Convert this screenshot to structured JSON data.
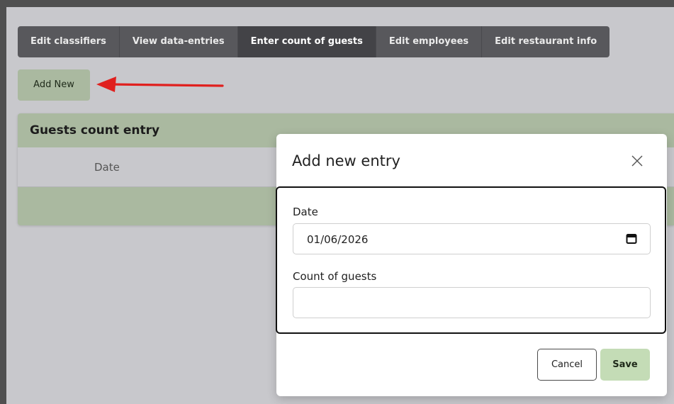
{
  "nav": {
    "items": [
      {
        "label": "Edit classifiers"
      },
      {
        "label": "View data-entries"
      },
      {
        "label": "Enter count of guests"
      },
      {
        "label": "Edit employees"
      },
      {
        "label": "Edit restaurant info"
      }
    ],
    "active_index": 2
  },
  "toolbar": {
    "add_new_label": "Add New"
  },
  "card": {
    "title": "Guests count entry",
    "columns": [
      "Date"
    ]
  },
  "modal": {
    "title": "Add new entry",
    "close_icon": "close-icon",
    "fields": {
      "date": {
        "label": "Date",
        "value": "01/06/2026",
        "icon": "calendar-icon"
      },
      "count": {
        "label": "Count of guests",
        "value": ""
      }
    },
    "cancel_label": "Cancel",
    "save_label": "Save"
  },
  "annotation": {
    "arrow_icon": "arrow-left-icon",
    "color": "#e0201e"
  },
  "colors": {
    "accent_green": "#aab9a0",
    "save_green": "#c4dcb6",
    "nav_bg": "#58585c",
    "nav_active": "#434347"
  }
}
